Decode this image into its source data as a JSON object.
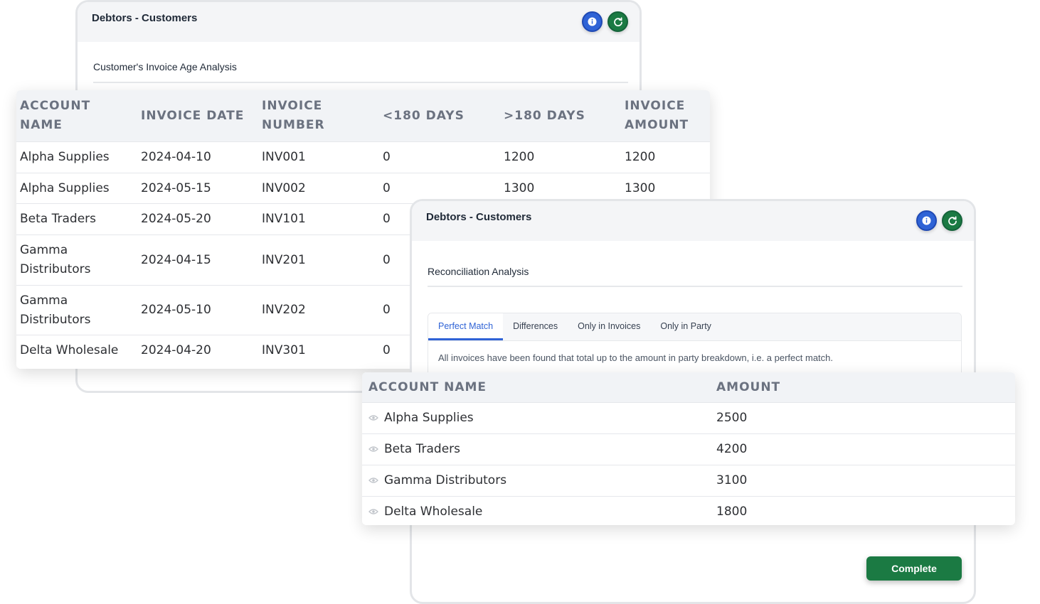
{
  "card1": {
    "title": "Debtors - Customers",
    "subtitle": "Customer's Invoice Age Analysis",
    "info_icon": "info-icon",
    "refresh_icon": "refresh-icon"
  },
  "aging_table": {
    "headers": [
      "Account Name",
      "Invoice Date",
      "Invoice Number",
      "<180 Days",
      ">180 Days",
      "Invoice Amount"
    ],
    "rows": [
      [
        "Alpha Supplies",
        "2024-04-10",
        "INV001",
        "0",
        "1200",
        "1200"
      ],
      [
        "Alpha Supplies",
        "2024-05-15",
        "INV002",
        "0",
        "1300",
        "1300"
      ],
      [
        "Beta Traders",
        "2024-05-20",
        "INV101",
        "0",
        "",
        ""
      ],
      [
        "Gamma Distributors",
        "2024-04-15",
        "INV201",
        "0",
        "",
        ""
      ],
      [
        "Gamma Distributors",
        "2024-05-10",
        "INV202",
        "0",
        "",
        ""
      ],
      [
        "Delta Wholesale",
        "2024-04-20",
        "INV301",
        "0",
        "",
        ""
      ]
    ]
  },
  "card2": {
    "title": "Debtors - Customers",
    "subtitle": "Reconciliation Analysis",
    "tabs": [
      "Perfect Match",
      "Differences",
      "Only in Invoices",
      "Only in Party"
    ],
    "active_tab": "Perfect Match",
    "message": "All invoices have been found that total up to the amount in party breakdown, i.e. a perfect match.",
    "complete_label": "Complete"
  },
  "recon_table": {
    "headers": [
      "Account Name",
      "Amount"
    ],
    "rows": [
      [
        "Alpha Supplies",
        "2500"
      ],
      [
        "Beta Traders",
        "4200"
      ],
      [
        "Gamma Distributors",
        "3100"
      ],
      [
        "Delta Wholesale",
        "1800"
      ]
    ],
    "row_icon": "eye-icon"
  },
  "colors": {
    "info": "#2f63d6",
    "success": "#1b7a43",
    "header_bg": "#f1f3f6"
  }
}
